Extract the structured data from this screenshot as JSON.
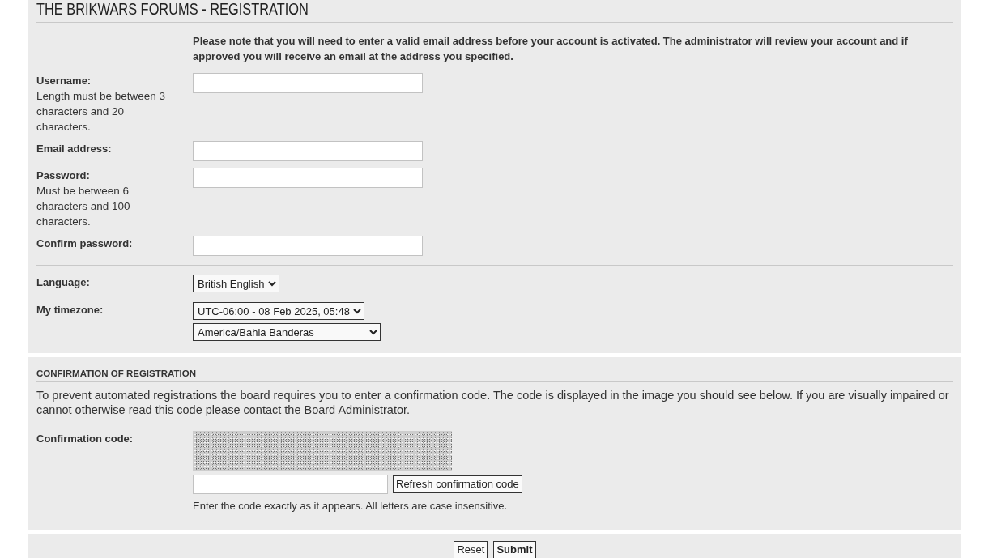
{
  "page_title": "THE BRIKWARS FORUMS - REGISTRATION",
  "notice": "Please note that you will need to enter a valid email address before your account is activated. The administrator will review your account and if approved you will receive an email at the address you specified.",
  "fields": [
    {
      "label": "Username:",
      "explain": "Length must be between 3 characters and 20 characters."
    },
    {
      "label": "Email address:"
    },
    {
      "label": "Password:",
      "explain": "Must be between 6 characters and 100 characters."
    },
    {
      "label": "Confirm password:"
    }
  ],
  "settings": [
    {
      "label": "Language:",
      "selects": [
        {
          "value": "British English"
        }
      ]
    },
    {
      "label": "My timezone:",
      "selects": [
        {
          "value": "UTC-06:00 - 08 Feb 2025, 05:48"
        },
        {
          "value": "America/Bahia Banderas"
        }
      ]
    }
  ],
  "confirmation": {
    "heading": "CONFIRMATION OF REGISTRATION",
    "text": "To prevent automated registrations the board requires you to enter a confirmation code. The code is displayed in the image you should see below. If you are visually impaired or cannot otherwise read this code please contact the Board Administrator.",
    "label": "Confirmation code:",
    "refresh_button": "Refresh confirmation code",
    "hint": "Enter the code exactly as it appears. All letters are case insensitive."
  },
  "buttons": [
    {
      "kind": "reset",
      "label": "Reset"
    },
    {
      "kind": "submit",
      "label": "Submit"
    }
  ]
}
